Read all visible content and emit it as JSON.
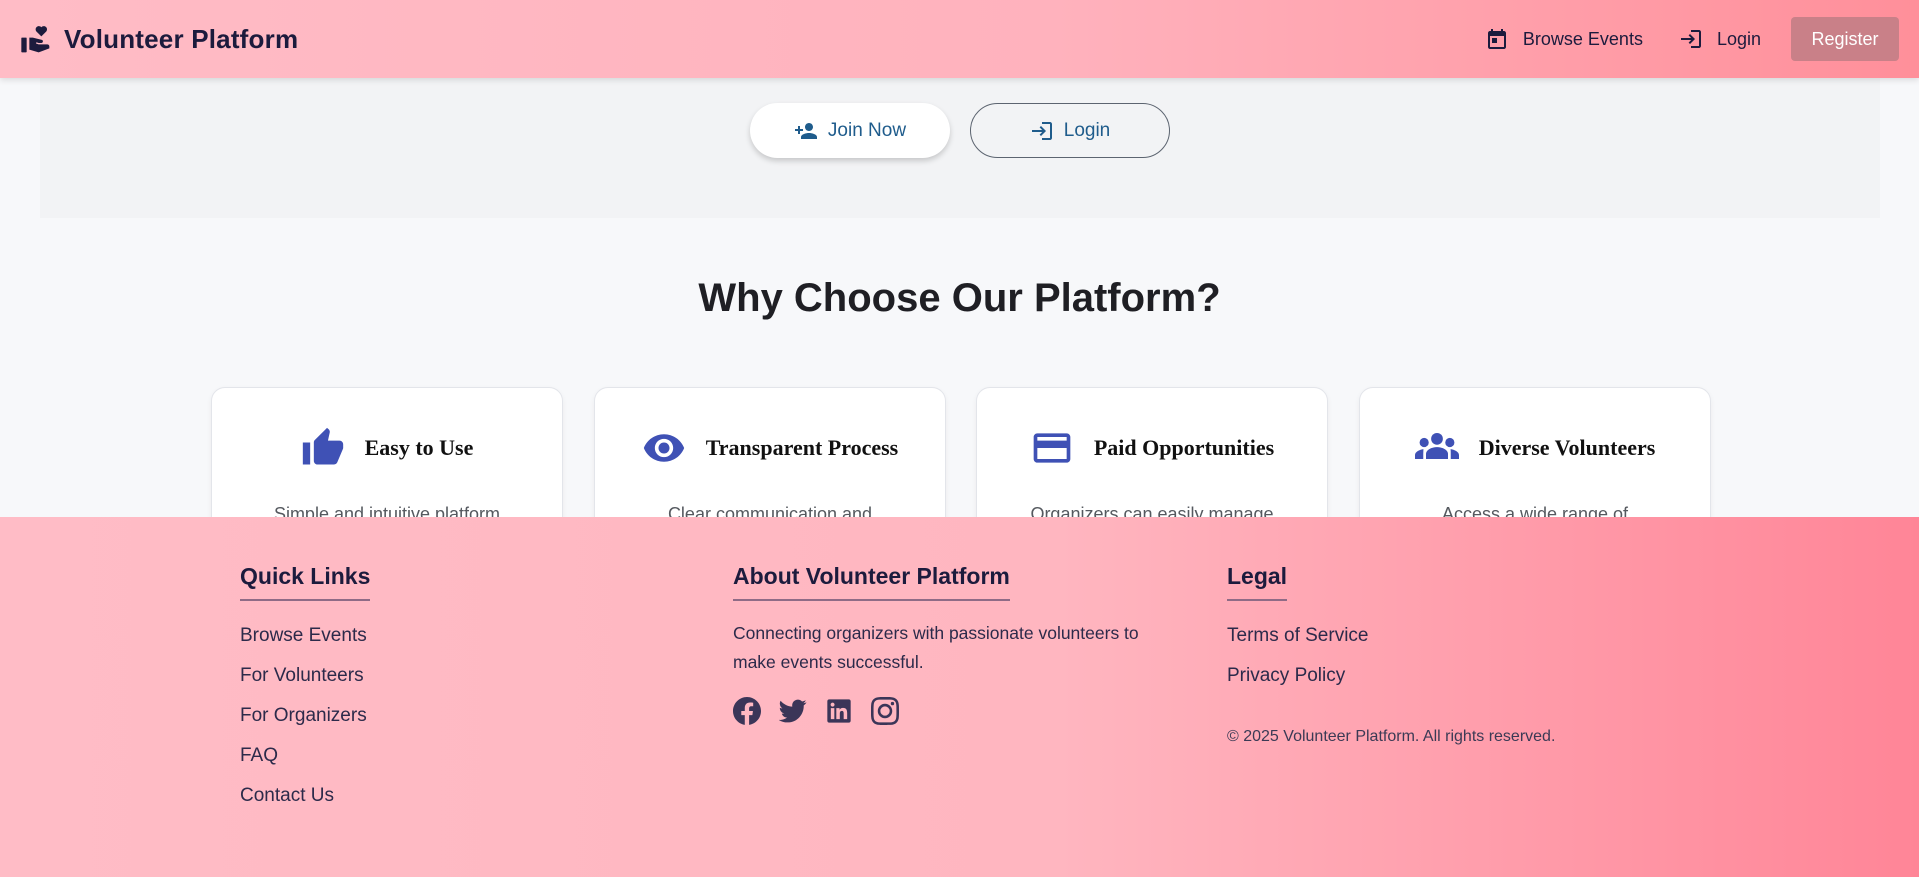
{
  "header": {
    "brand": "Volunteer Platform",
    "logo_icon": "volunteer-hand-heart-icon",
    "nav": {
      "browse_events": "Browse Events",
      "browse_icon": "calendar-icon",
      "login": "Login",
      "login_icon": "login-icon",
      "register": "Register"
    }
  },
  "hero": {
    "join_now": "Join Now",
    "join_icon": "person-add-icon",
    "login": "Login",
    "login_icon": "login-icon"
  },
  "features": {
    "title": "Why Choose Our Platform?",
    "cards": [
      {
        "title": "Easy to Use",
        "icon": "thumbs-up-icon",
        "desc": "Simple and intuitive platform"
      },
      {
        "title": "Transparent Process",
        "icon": "eye-icon",
        "desc": "Clear communication and"
      },
      {
        "title": "Paid Opportunities",
        "icon": "credit-card-icon",
        "desc": "Organizers can easily manage"
      },
      {
        "title": "Diverse Volunteers",
        "icon": "group-icon",
        "desc": "Access a wide range of"
      }
    ]
  },
  "footer": {
    "quick_links": {
      "heading": "Quick Links",
      "items": [
        "Browse Events",
        "For Volunteers",
        "For Organizers",
        "FAQ",
        "Contact Us"
      ]
    },
    "about": {
      "heading": "About Volunteer Platform",
      "text": "Connecting organizers with passionate volunteers to make events successful.",
      "socials": [
        "facebook-icon",
        "twitter-icon",
        "linkedin-icon",
        "instagram-icon"
      ]
    },
    "legal": {
      "heading": "Legal",
      "items": [
        "Terms of Service",
        "Privacy Policy"
      ],
      "copyright": "© 2025 Volunteer Platform. All rights reserved."
    }
  },
  "colors": {
    "header_gradient_start": "#ffbcc6",
    "header_gradient_end": "#ff8f9a",
    "register_button": "#c98088",
    "feature_icon": "#3f51b5",
    "cta_text": "#1f5c8c",
    "dark_text": "#1c1b3d"
  }
}
